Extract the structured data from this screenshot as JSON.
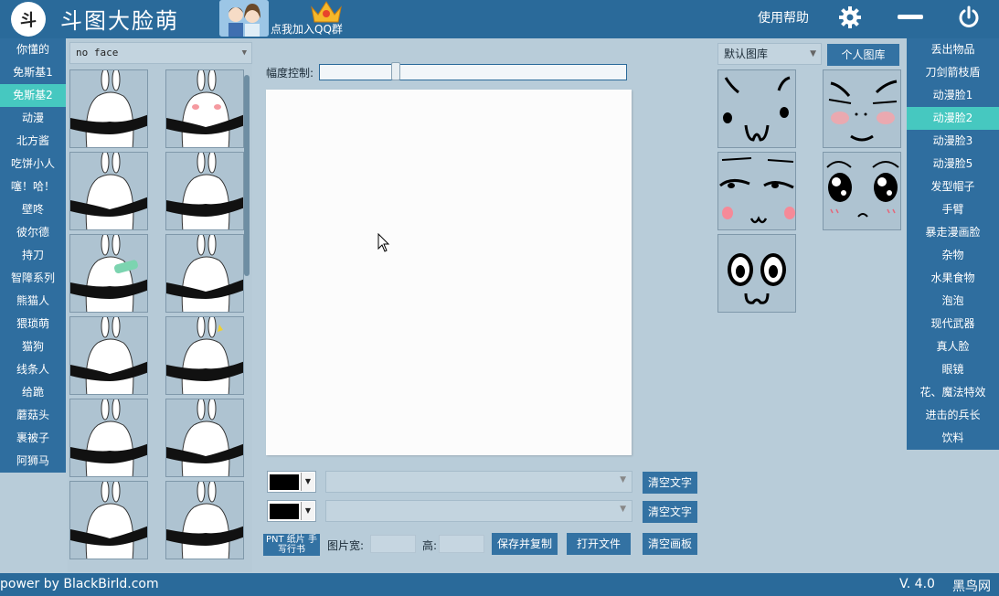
{
  "app": {
    "title": "斗图大脸萌",
    "logo_text": "斗",
    "qq_link": "点我加入QQ群",
    "help": "使用帮助",
    "brand_color": "#2a6a9a",
    "active_color": "#46c8c0"
  },
  "left_categories": [
    "你懂的",
    "免斯基1",
    "免斯基2",
    "动漫",
    "北方酱",
    "吃饼小人",
    "噻！哈！",
    "壁咚",
    "彼尔德",
    "持刀",
    "智障系列",
    "熊猫人",
    "猥琐萌",
    "猫狗",
    "线条人",
    "给跪",
    "蘑菇头",
    "裹被子",
    "阿狮马"
  ],
  "left_active_index": 2,
  "sticker_panel": {
    "face_select": "no face"
  },
  "canvas_area": {
    "slider_label": "幅度控制:",
    "slider_value": 0.25
  },
  "library": {
    "select_value": "默认图库",
    "personal_button": "个人图库"
  },
  "right_categories": [
    "丢出物品",
    "刀剑箭枝盾",
    "动漫脸1",
    "动漫脸2",
    "动漫脸3",
    "动漫脸5",
    "发型帽子",
    "手臂",
    "暴走漫画脸",
    "杂物",
    "水果食物",
    "泡泡",
    "现代武器",
    "真人脸",
    "眼镜",
    "花、魔法特效",
    "进击的兵长",
    "饮料"
  ],
  "right_active_index": 3,
  "controls": {
    "clear_text": "清空文字",
    "handwrite": "PNT 纸片 手写行书",
    "width_label": "图片宽:",
    "height_label": "高:",
    "save_copy": "保存并复制",
    "open_file": "打开文件",
    "clear_canvas": "清空画板"
  },
  "status": {
    "power_by": "power by BlackBirld.com",
    "version": "V. 4.0",
    "site": "黑鸟网"
  }
}
